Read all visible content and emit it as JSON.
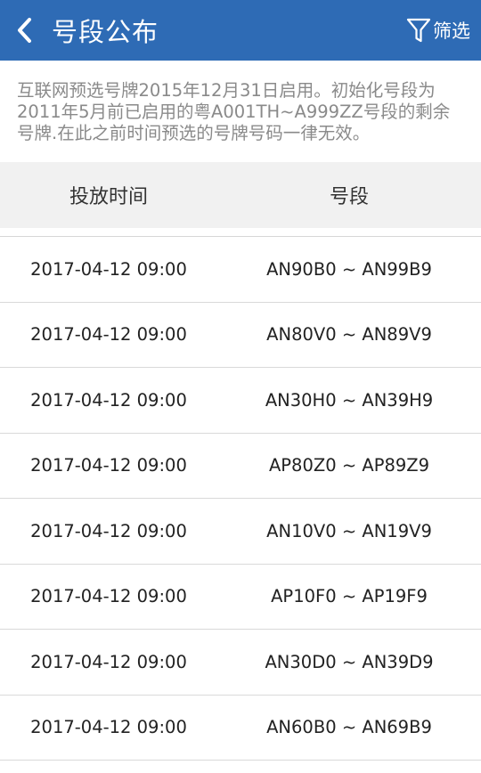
{
  "header": {
    "title": "号段公布",
    "back_icon": "chevron-left-icon",
    "filter_icon": "funnel-icon",
    "filter_label": "筛选",
    "bar_color": "#2e6bb5"
  },
  "notice": {
    "text": "互联网预选号牌2015年12月31日启用。初始化号段为2011年5月前已启用的粤A001TH~A999ZZ号段的剩余号牌.在此之前时间预选的号牌号码一律无效。"
  },
  "table": {
    "columns": [
      "投放时间",
      "号段"
    ],
    "rows": [
      {
        "time": "2017-04-12 09:00",
        "range": "AN90B0 ~ AN99B9"
      },
      {
        "time": "2017-04-12 09:00",
        "range": "AN80V0 ~ AN89V9"
      },
      {
        "time": "2017-04-12 09:00",
        "range": "AN30H0 ~ AN39H9"
      },
      {
        "time": "2017-04-12 09:00",
        "range": "AP80Z0 ~ AP89Z9"
      },
      {
        "time": "2017-04-12 09:00",
        "range": "AN10V0 ~ AN19V9"
      },
      {
        "time": "2017-04-12 09:00",
        "range": "AP10F0 ~ AP19F9"
      },
      {
        "time": "2017-04-12 09:00",
        "range": "AN30D0 ~ AN39D9"
      },
      {
        "time": "2017-04-12 09:00",
        "range": "AN60B0 ~ AN69B9"
      }
    ]
  }
}
